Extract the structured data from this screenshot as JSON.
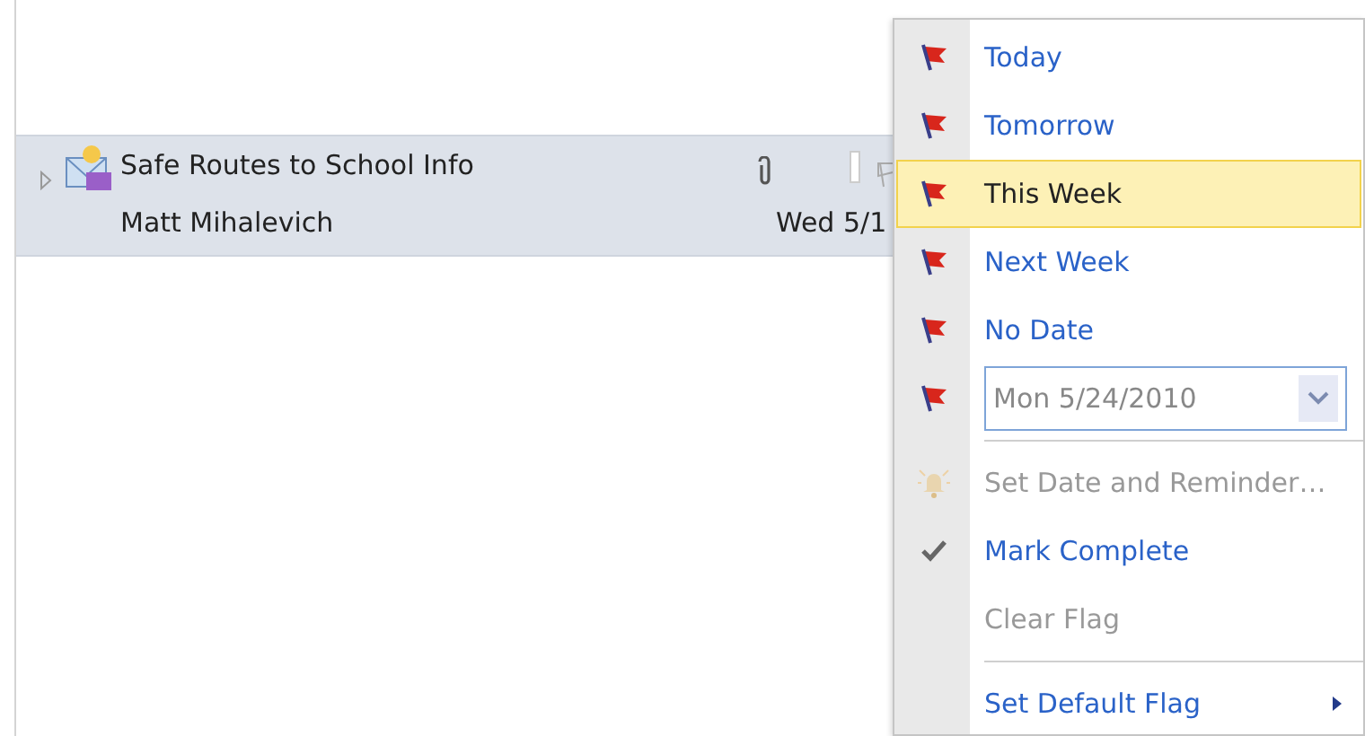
{
  "message": {
    "subject": "Safe Routes to School Info",
    "sender": "Matt Mihalevich",
    "date": "Wed 5/1",
    "has_attachment": true,
    "expanded": false
  },
  "menu": [
    {
      "kind": "flag",
      "label": "Today",
      "selected": false,
      "disabled": false
    },
    {
      "kind": "flag",
      "label": "Tomorrow",
      "selected": false,
      "disabled": false
    },
    {
      "kind": "flag",
      "label": "This Week",
      "selected": true,
      "disabled": false
    },
    {
      "kind": "flag",
      "label": "Next Week",
      "selected": false,
      "disabled": false
    },
    {
      "kind": "flag",
      "label": "No Date",
      "selected": false,
      "disabled": false
    },
    {
      "kind": "date",
      "value": "Mon 5/24/2010"
    },
    {
      "kind": "separator"
    },
    {
      "kind": "bell",
      "label": "Set Date and Reminder…",
      "selected": false,
      "disabled": true
    },
    {
      "kind": "check",
      "label": "Mark Complete",
      "selected": false,
      "disabled": false
    },
    {
      "kind": "plain",
      "label": "Clear Flag",
      "selected": false,
      "disabled": true
    },
    {
      "kind": "separator"
    },
    {
      "kind": "submenu",
      "label": "Set Default Flag",
      "selected": false,
      "disabled": false
    }
  ]
}
